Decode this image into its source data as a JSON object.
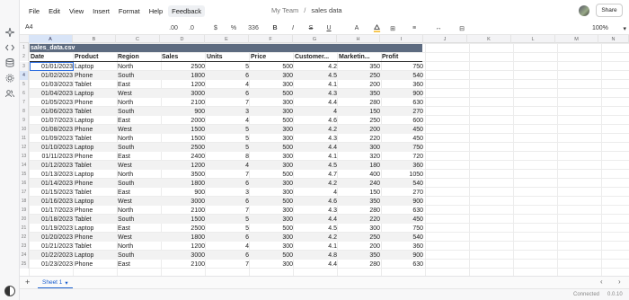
{
  "menu": [
    "File",
    "Edit",
    "View",
    "Insert",
    "Format",
    "Help",
    "Feedback"
  ],
  "title": {
    "workspace": "My Team",
    "separator": "/",
    "name": "sales data"
  },
  "share_label": "Share",
  "toolbar": {
    "cell_ref": "A4",
    "tools": [
      ".00",
      ".0",
      "$",
      "%",
      "336",
      "A",
      "B",
      "I",
      "S",
      "U",
      "≡",
      "⊞",
      "↔",
      "⊟"
    ],
    "zoom": "100%"
  },
  "columns": [
    "A",
    "B",
    "C",
    "D",
    "E",
    "F",
    "G",
    "H",
    "I",
    "J",
    "K",
    "L",
    "M",
    "N"
  ],
  "rows": [
    "1",
    "2",
    "3",
    "4",
    "5",
    "6",
    "7",
    "8",
    "9",
    "10",
    "11",
    "12",
    "13",
    "14",
    "15",
    "16",
    "17",
    "18",
    "19",
    "20",
    "21",
    "22",
    "23",
    "24",
    "25"
  ],
  "sheet": {
    "title": "sales_data.csv",
    "headers": [
      "Date",
      "Product",
      "Region",
      "Sales",
      "Units",
      "Price",
      "Customer...",
      "Marketin...",
      "Profit"
    ],
    "records": [
      [
        "01/01/2023",
        "Laptop",
        "North",
        "2500",
        "5",
        "500",
        "4.2",
        "350",
        "750"
      ],
      [
        "01/02/2023",
        "Phone",
        "South",
        "1800",
        "6",
        "300",
        "4.5",
        "250",
        "540"
      ],
      [
        "01/03/2023",
        "Tablet",
        "East",
        "1200",
        "4",
        "300",
        "4.1",
        "200",
        "360"
      ],
      [
        "01/04/2023",
        "Laptop",
        "West",
        "3000",
        "6",
        "500",
        "4.3",
        "350",
        "900"
      ],
      [
        "01/05/2023",
        "Phone",
        "North",
        "2100",
        "7",
        "300",
        "4.4",
        "280",
        "630"
      ],
      [
        "01/06/2023",
        "Tablet",
        "South",
        "900",
        "3",
        "300",
        "4",
        "150",
        "270"
      ],
      [
        "01/07/2023",
        "Laptop",
        "East",
        "2000",
        "4",
        "500",
        "4.6",
        "250",
        "600"
      ],
      [
        "01/08/2023",
        "Phone",
        "West",
        "1500",
        "5",
        "300",
        "4.2",
        "200",
        "450"
      ],
      [
        "01/09/2023",
        "Tablet",
        "North",
        "1500",
        "5",
        "300",
        "4.3",
        "220",
        "450"
      ],
      [
        "01/10/2023",
        "Laptop",
        "South",
        "2500",
        "5",
        "500",
        "4.4",
        "300",
        "750"
      ],
      [
        "01/11/2023",
        "Phone",
        "East",
        "2400",
        "8",
        "300",
        "4.1",
        "320",
        "720"
      ],
      [
        "01/12/2023",
        "Tablet",
        "West",
        "1200",
        "4",
        "300",
        "4.5",
        "180",
        "360"
      ],
      [
        "01/13/2023",
        "Laptop",
        "North",
        "3500",
        "7",
        "500",
        "4.7",
        "400",
        "1050"
      ],
      [
        "01/14/2023",
        "Phone",
        "South",
        "1800",
        "6",
        "300",
        "4.2",
        "240",
        "540"
      ],
      [
        "01/15/2023",
        "Tablet",
        "East",
        "900",
        "3",
        "300",
        "4",
        "150",
        "270"
      ],
      [
        "01/16/2023",
        "Laptop",
        "West",
        "3000",
        "6",
        "500",
        "4.6",
        "350",
        "900"
      ],
      [
        "01/17/2023",
        "Phone",
        "North",
        "2100",
        "7",
        "300",
        "4.3",
        "280",
        "630"
      ],
      [
        "01/18/2023",
        "Tablet",
        "South",
        "1500",
        "5",
        "300",
        "4.4",
        "220",
        "450"
      ],
      [
        "01/19/2023",
        "Laptop",
        "East",
        "2500",
        "5",
        "500",
        "4.5",
        "300",
        "750"
      ],
      [
        "01/20/2023",
        "Phone",
        "West",
        "1800",
        "6",
        "300",
        "4.2",
        "250",
        "540"
      ],
      [
        "01/21/2023",
        "Tablet",
        "North",
        "1200",
        "4",
        "300",
        "4.1",
        "200",
        "360"
      ],
      [
        "01/22/2023",
        "Laptop",
        "South",
        "3000",
        "6",
        "500",
        "4.8",
        "350",
        "900"
      ],
      [
        "01/23/2023",
        "Phone",
        "East",
        "2100",
        "7",
        "300",
        "4.4",
        "280",
        "630"
      ]
    ]
  },
  "tabs": {
    "add": "+",
    "sheet_name": "Sheet 1",
    "dropdown": "▾",
    "prev": "‹",
    "next": "›"
  },
  "status": {
    "connection": "Connected",
    "version": "0.0.10"
  },
  "colors": {
    "accent": "#2f6fe0",
    "title_band": "#5d6b80",
    "row_stripe": "#f2f2f2"
  }
}
